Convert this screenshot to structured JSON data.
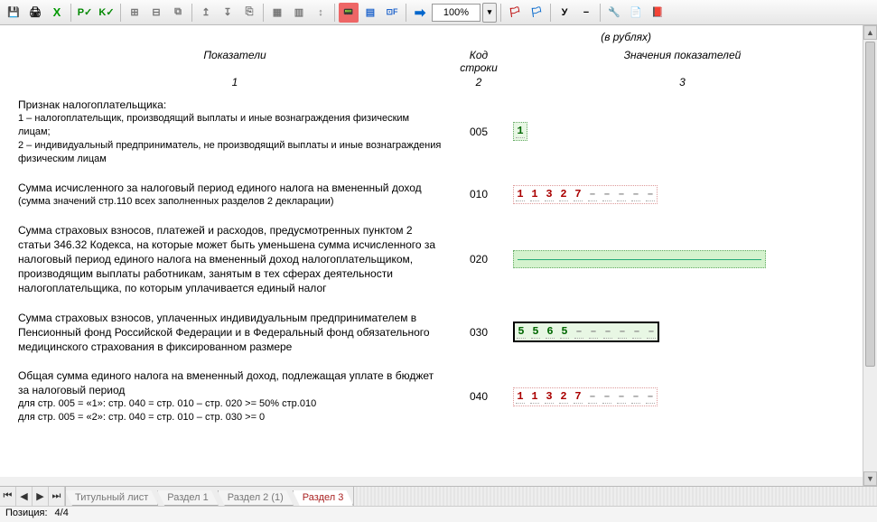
{
  "toolbar": {
    "zoom": "100%"
  },
  "doc": {
    "currency_note": "(в рублях)",
    "header": {
      "c1": "Показатели",
      "c2": "Код строки",
      "c3": "Значения показателей"
    },
    "nums": {
      "c1": "1",
      "c2": "2",
      "c3": "3"
    },
    "row005": {
      "title": "Признак налогоплательщика:",
      "line1": "1 – налогоплательщик, производящий выплаты и иные вознаграждения физическим лицам;",
      "line2": "2 – индивидуальный предприниматель, не производящий выплаты и иные вознаграждения физическим лицам",
      "code": "005",
      "val": [
        "1"
      ]
    },
    "row010": {
      "title": "Сумма исчисленного за налоговый период единого налога на вмененный доход",
      "sub": "(сумма значений стр.110 всех заполненных разделов 2 декларации)",
      "code": "010",
      "val": [
        "1",
        "1",
        "3",
        "2",
        "7",
        "–",
        "–",
        "–",
        "–",
        "–"
      ]
    },
    "row020": {
      "title": "Сумма страховых взносов, платежей и расходов, предусмотренных пунктом 2 статьи 346.32 Кодекса, на которые может быть уменьшена сумма исчисленного за налоговый период единого налога на вмененный доход налогоплательщиком, производящим выплаты работникам, занятым в тех сферах деятельности налогоплательщика, по которым уплачивается единый налог",
      "code": "020"
    },
    "row030": {
      "title": "Сумма страховых взносов, уплаченных индивидуальным предпринимателем в Пенсионный фонд Российской Федерации и в Федеральный фонд обязательного медицинского страхования в фиксированном размере",
      "code": "030",
      "val": [
        "5",
        "5",
        "6",
        "5",
        "–",
        "–",
        "–",
        "–",
        "–",
        "–"
      ]
    },
    "row040": {
      "title": "Общая сумма единого налога на вмененный доход, подлежащая уплате в бюджет за налоговый период",
      "sub1": "для стр. 005 = «1»: стр. 040 = стр. 010 – стр. 020 >= 50% стр.010",
      "sub2": "для стр. 005 = «2»: стр. 040 = стр. 010 – стр. 030 >= 0",
      "code": "040",
      "val": [
        "1",
        "1",
        "3",
        "2",
        "7",
        "–",
        "–",
        "–",
        "–",
        "–"
      ]
    }
  },
  "tabs": [
    "Титульный лист",
    "Раздел 1",
    "Раздел 2 (1)",
    "Раздел 3"
  ],
  "status": {
    "label": "Позиция:",
    "value": "4/4"
  }
}
